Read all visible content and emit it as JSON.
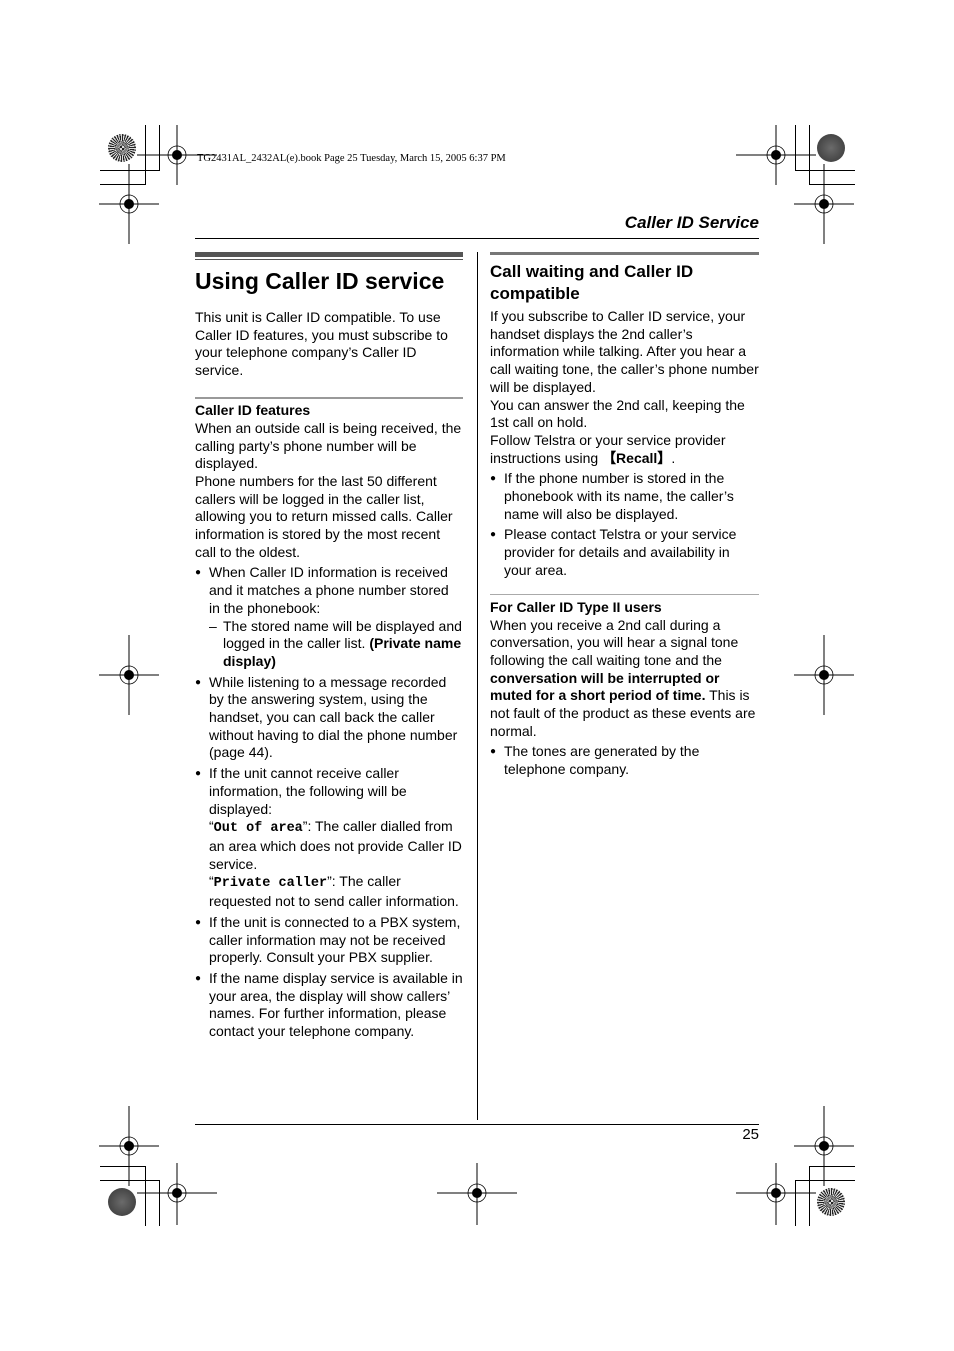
{
  "slug_line": "TG2431AL_2432AL(e).book  Page 25  Tuesday, March 15, 2005  6:37 PM",
  "running_header": "Caller ID Service",
  "left_column": {
    "title": "Using Caller ID service",
    "intro": "This unit is Caller ID compatible. To use Caller ID features, you must subscribe to your telephone company’s Caller ID service.",
    "features_heading": "Caller ID features",
    "features_para1": "When an outside call is being received, the calling party’s phone number will be displayed.",
    "features_para2": "Phone numbers for the last 50 different callers will be logged in the caller list, allowing you to return missed calls. Caller information is stored by the most recent call to the oldest.",
    "bullets": [
      {
        "text": "When Caller ID information is received and it matches a phone number stored in the phonebook:",
        "sub": "The stored name will be displayed and logged in the caller list. ",
        "sub_bold": "(Private name display)"
      },
      {
        "text": "While listening to a message recorded by the answering system, using the handset, you can call back the caller without having to dial the phone number (page 44)."
      },
      {
        "text": "If the unit cannot receive caller information, the following will be displayed:",
        "code1": "Out of area",
        "code1_desc": ": The caller dialled from an area which does not provide Caller ID service.",
        "code2": "Private caller",
        "code2_desc": ": The caller requested not to send caller information."
      },
      {
        "text": "If the unit is connected to a PBX system, caller information may not be received properly. Consult your PBX supplier."
      },
      {
        "text": "If the name display service is available in your area, the display will show callers’ names. For further information, please contact your telephone company."
      }
    ]
  },
  "right_column": {
    "heading": "Call waiting and Caller ID compatible",
    "para1": "If you subscribe to Caller ID service, your handset displays the 2nd caller’s information while talking. After you hear a call waiting tone, the caller’s phone number will be displayed.",
    "para2": "You can answer the 2nd call, keeping the 1st call on hold.",
    "para3_prefix": "Follow Telstra or your service provider instructions using ",
    "recall_key": "【Recall】",
    "para3_suffix": ".",
    "bullets": [
      "If the phone number is stored in the phonebook with its name, the caller’s name will also be displayed.",
      "Please contact Telstra or your service provider for details and availability in your area."
    ],
    "type2_heading": "For Caller ID Type II users",
    "type2_para_normal1": "When you receive a 2nd call during a conversation, you will hear a signal tone following the call waiting tone and the ",
    "type2_para_bold": "conversation will be interrupted or muted for a short period of time.",
    "type2_para_normal2": " This is not fault of the product as these events are normal.",
    "type2_bullets": [
      "The tones are generated by the telephone company."
    ]
  },
  "page_number": "25"
}
